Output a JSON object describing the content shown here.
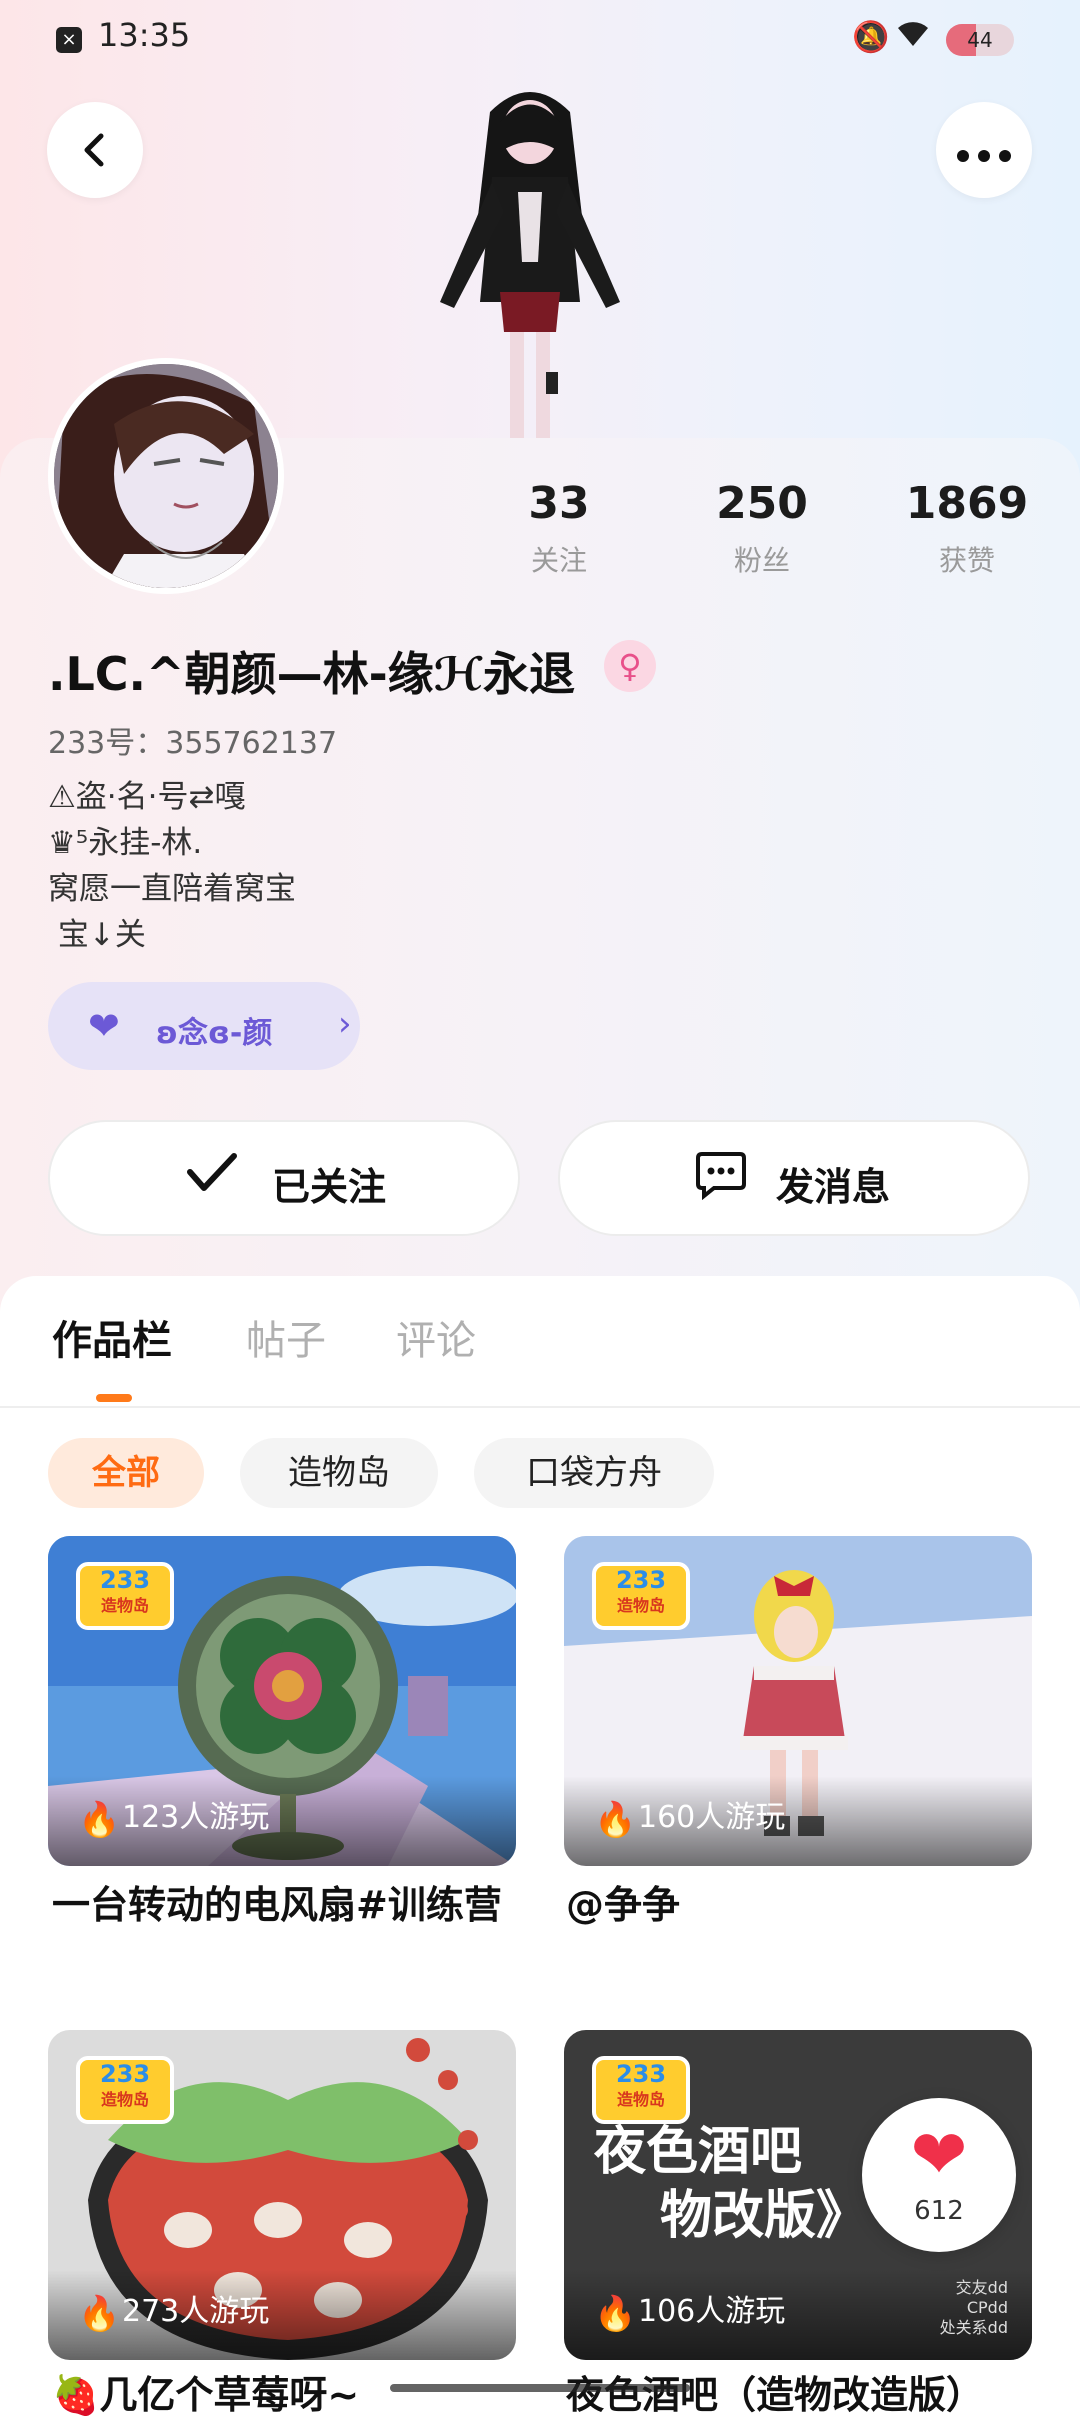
{
  "status_bar": {
    "time": "13:35",
    "battery_level": "44",
    "battery_fraction": 0.44,
    "icons": [
      "close-notification-icon",
      "bell-muted-icon",
      "wifi-icon",
      "battery-icon"
    ]
  },
  "header": {
    "back_icon": "‹",
    "more_icon": "•••"
  },
  "profile": {
    "username": ".LC.^朝颜—林-缘ℋ永退",
    "gender_symbol": "♀",
    "uid_label": "233号：",
    "uid": "355762137",
    "bio_lines": [
      "⚠盗·名·号⇄嘎",
      "♛⁵永挂-林.",
      "窝愿一直陪着窝宝",
      " 宝↓关"
    ],
    "tag_label": "ʚ念ɞ-颜",
    "stats": [
      {
        "value": "33",
        "label": "关注"
      },
      {
        "value": "250",
        "label": "粉丝"
      },
      {
        "value": "1869",
        "label": "获赞"
      }
    ]
  },
  "actions": {
    "follow_label": "已关注",
    "message_label": "发消息"
  },
  "tabs": [
    {
      "label": "作品栏",
      "active": true
    },
    {
      "label": "帖子",
      "active": false
    },
    {
      "label": "评论",
      "active": false
    }
  ],
  "filters": [
    {
      "label": "全部",
      "active": true
    },
    {
      "label": "造物岛",
      "active": false
    },
    {
      "label": "口袋方舟",
      "active": false
    }
  ],
  "badge": {
    "number": "233",
    "text": "造物岛"
  },
  "games": [
    {
      "plays": "123人游玩",
      "title": "一台转动的电风扇#训练营",
      "theme": "fan"
    },
    {
      "plays": "160人游玩",
      "title": "@争争",
      "theme": "doll"
    },
    {
      "plays": "273人游玩",
      "title": "🍓几亿个草莓呀~",
      "theme": "strawberry"
    },
    {
      "plays": "106人游玩",
      "title": "夜色酒吧（造物改造版）",
      "theme": "bar",
      "overlay_lines": [
        "夜色酒吧",
        "物改版》"
      ],
      "corner_lines": [
        "交友dd",
        "CPdd",
        "处关系dd"
      ]
    }
  ],
  "like_float": {
    "icon": "heart-icon",
    "count": "612"
  },
  "colors": {
    "accent": "#ff6b12",
    "tag": "#6c59d6",
    "like": "#f0304a"
  }
}
